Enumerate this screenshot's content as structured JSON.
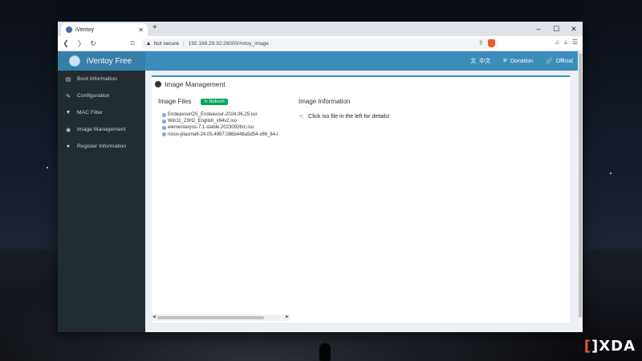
{
  "browser": {
    "tab_title": "iVentoy",
    "new_tab": "+",
    "not_secure": "Not secure",
    "url": "192.168.29.32:26000/#vtoy_image",
    "window_controls": [
      "–",
      "☐",
      "✕"
    ]
  },
  "app": {
    "brand": "iVentoy Free",
    "nav_language": "中文",
    "nav_donation": "Donation",
    "nav_official": "Official"
  },
  "sidebar": {
    "items": [
      {
        "label": "Boot Information",
        "icon": "list-icon"
      },
      {
        "label": "Configuration",
        "icon": "wrench-icon"
      },
      {
        "label": "MAC Filter",
        "icon": "filter-icon"
      },
      {
        "label": "Image Management",
        "icon": "disc-icon"
      },
      {
        "label": "Register Information",
        "icon": "user-icon"
      }
    ]
  },
  "main": {
    "title": "Image Management",
    "image_files_label": "Image Files",
    "refresh_label": "Refresh",
    "files": [
      "EndeavourOS_Endeavour-2024.06.25.iso",
      "Win11_23H2_English_x64v2.iso",
      "elementaryos-7.1-stable.20230926rc.iso",
      "nixos-plasma6-24.05.4997.086b448a5d54-x86_64-l"
    ],
    "image_info_label": "Image Information",
    "image_info_text": "Click iso file in the left for details!"
  },
  "watermark": {
    "brand": "XDA"
  },
  "colors": {
    "header": "#3c8dbc",
    "brand_bg": "#367fa9",
    "sidebar": "#222d32",
    "refresh": "#00a65a"
  }
}
